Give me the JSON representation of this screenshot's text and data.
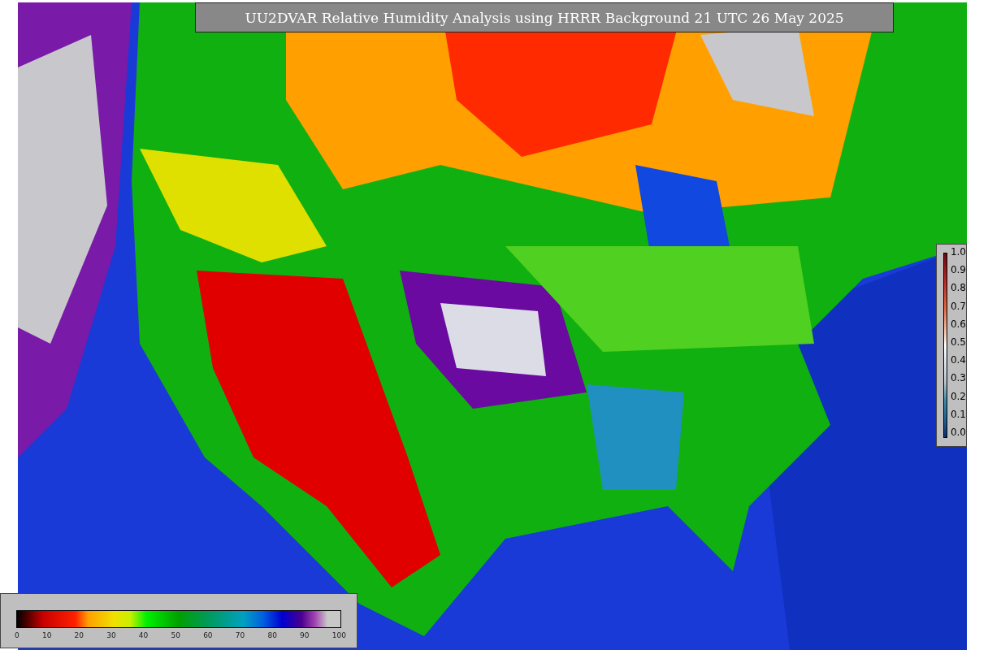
{
  "title": "UU2DVAR Relative Humidity Analysis using HRRR Background 21 UTC 26 May 2025",
  "humidity_colorbar": {
    "ticks": [
      "0",
      "10",
      "20",
      "30",
      "40",
      "50",
      "60",
      "70",
      "80",
      "90",
      "100"
    ]
  },
  "increment_colorbar": {
    "ticks": [
      "1.0",
      "0.9",
      "0.8",
      "0.7",
      "0.6",
      "0.5",
      "0.4",
      "0.3",
      "0.2",
      "0.1",
      "0.0"
    ]
  }
}
